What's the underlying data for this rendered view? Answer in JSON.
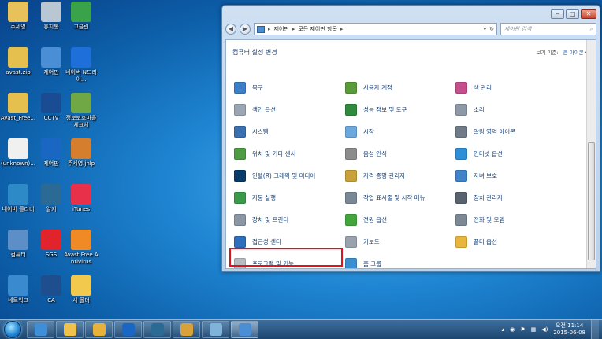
{
  "desktop": {
    "icons": [
      {
        "label": "주세영",
        "icon": "user-folder-icon",
        "color": "#e8c15a"
      },
      {
        "label": "휴지통",
        "icon": "recycle-bin-icon",
        "color": "#b9c7d5"
      },
      {
        "label": "고클린",
        "icon": "broom-icon",
        "color": "#3aa34a"
      },
      {
        "label": "avast.zip",
        "icon": "zip-folder-icon",
        "color": "#e6c04e"
      },
      {
        "label": "제어판",
        "icon": "control-panel-icon",
        "color": "#4a8fd6"
      },
      {
        "label": "네이버 N드라이...",
        "icon": "naver-ndrive-icon",
        "color": "#1e6fd9"
      },
      {
        "label": "Avast_Free...",
        "icon": "zip-folder-icon",
        "color": "#e6c04e"
      },
      {
        "label": "CCTV",
        "icon": "adt-icon",
        "color": "#1a4c94"
      },
      {
        "label": "정보보호마을 체크체",
        "icon": "shield-check-icon",
        "color": "#6fa844"
      },
      {
        "label": "(unknown)...",
        "icon": "document-icon",
        "color": "#f0f0f0"
      },
      {
        "label": "제어판",
        "icon": "security-circle-icon",
        "color": "#1966c3"
      },
      {
        "label": "주세영.jnlp",
        "icon": "java-document-icon",
        "color": "#d47e2e"
      },
      {
        "label": "네이버 클리너",
        "icon": "cleaner-icon",
        "color": "#2d8ac7"
      },
      {
        "label": "알키",
        "icon": "alkey-icon",
        "color": "#2b6a95"
      },
      {
        "label": "iTunes",
        "icon": "itunes-icon",
        "color": "#e9304a"
      },
      {
        "label": "컴퓨터",
        "icon": "computer-icon",
        "color": "#5c8fc7"
      },
      {
        "label": "SGS",
        "icon": "no-sign-icon",
        "color": "#e1242b"
      },
      {
        "label": "Avast Free Antivirus",
        "icon": "avast-icon",
        "color": "#f08a24"
      },
      {
        "label": "네트워크",
        "icon": "network-icon",
        "color": "#3a8ad0"
      },
      {
        "label": "CA",
        "icon": "bank-icon",
        "color": "#1f4e8f"
      },
      {
        "label": "새 폴더",
        "icon": "folder-icon",
        "color": "#f2c94c"
      }
    ]
  },
  "window": {
    "breadcrumb": [
      "제어판",
      "모든 제어판 항목"
    ],
    "search_placeholder": "제어판 검색",
    "header_title": "컴퓨터 설정 변경",
    "view_label": "보기 기준:",
    "view_value": "큰 아이콘 ▾",
    "items": [
      {
        "label": "복구",
        "icon": "recovery-icon",
        "color": "#3b7fc6"
      },
      {
        "label": "사용자 계정",
        "icon": "user-accounts-icon",
        "color": "#5a9a3a"
      },
      {
        "label": "색 관리",
        "icon": "color-management-icon",
        "color": "#c54e8c"
      },
      {
        "label": "색인 옵션",
        "icon": "indexing-icon",
        "color": "#9aa6b3"
      },
      {
        "label": "성능 정보 및 도구",
        "icon": "performance-icon",
        "color": "#2f8a3d"
      },
      {
        "label": "소리",
        "icon": "sound-icon",
        "color": "#8d99a6"
      },
      {
        "label": "시스템",
        "icon": "system-icon",
        "color": "#3a6fb0"
      },
      {
        "label": "시작",
        "icon": "getting-started-icon",
        "color": "#6aa8dd"
      },
      {
        "label": "알림 영역 아이콘",
        "icon": "notification-icon",
        "color": "#6f7b88"
      },
      {
        "label": "위치 및 기타 센서",
        "icon": "sensor-icon",
        "color": "#4f9a45"
      },
      {
        "label": "음성 인식",
        "icon": "microphone-icon",
        "color": "#8c8c8c"
      },
      {
        "label": "인터넷 옵션",
        "icon": "internet-options-icon",
        "color": "#2e8fd6"
      },
      {
        "label": "인텔(R) 그래픽 및 미디어",
        "icon": "intel-graphics-icon",
        "color": "#0a3a6a"
      },
      {
        "label": "자격 증명 관리자",
        "icon": "credential-icon",
        "color": "#c9a13a"
      },
      {
        "label": "자녀 보호",
        "icon": "parental-control-icon",
        "color": "#3f83c9"
      },
      {
        "label": "자동 실행",
        "icon": "autoplay-icon",
        "color": "#3a9a49"
      },
      {
        "label": "작업 표시줄 및 시작 메뉴",
        "icon": "taskbar-icon",
        "color": "#7a8896"
      },
      {
        "label": "장치 관리자",
        "icon": "device-manager-icon",
        "color": "#58636f"
      },
      {
        "label": "장치 및 프린터",
        "icon": "printer-icon",
        "color": "#8a96a4"
      },
      {
        "label": "전원 옵션",
        "icon": "power-options-icon",
        "color": "#43a63c"
      },
      {
        "label": "전화 및 모뎀",
        "icon": "phone-modem-icon",
        "color": "#7c8894"
      },
      {
        "label": "접근성 센터",
        "icon": "accessibility-icon",
        "color": "#2f6dbd"
      },
      {
        "label": "키보드",
        "icon": "keyboard-icon",
        "color": "#9aa3ad"
      },
      {
        "label": "폴더 옵션",
        "icon": "folder-options-icon",
        "color": "#e8b63c"
      },
      {
        "label": "프로그램 및 기능",
        "icon": "programs-features-icon",
        "color": "#b8bcc2"
      },
      {
        "label": "홈 그룹",
        "icon": "homegroup-icon",
        "color": "#3b8fd1"
      }
    ]
  },
  "taskbar": {
    "apps": [
      {
        "icon": "explorer-icon",
        "color": "#3f8fd8"
      },
      {
        "icon": "folder-icon",
        "color": "#f0c14b"
      },
      {
        "icon": "yellow-folder-icon",
        "color": "#e7b23a"
      },
      {
        "icon": "security-icon",
        "color": "#1a66c5"
      },
      {
        "icon": "alkey-icon",
        "color": "#2b6a95"
      },
      {
        "icon": "key-icon",
        "color": "#d9a13a"
      },
      {
        "icon": "paint-icon",
        "color": "#7fb3d9"
      },
      {
        "icon": "control-panel-icon",
        "color": "#4a8fd6"
      }
    ],
    "time": "오전 11:14",
    "date": "2015-06-08"
  }
}
